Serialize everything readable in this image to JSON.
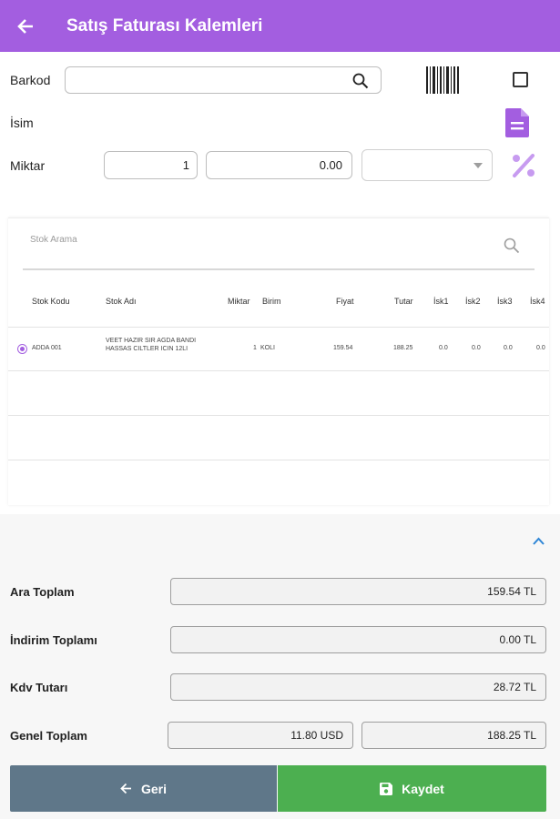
{
  "header": {
    "title": "Satış Faturası Kalemleri"
  },
  "form": {
    "barcode_label": "Barkod",
    "name_label": "İsim",
    "qty_label": "Miktar",
    "qty_value": "1",
    "price_value": "0.00"
  },
  "stock": {
    "search_placeholder": "Stok Arama",
    "columns": [
      "Stok Kodu",
      "Stok Adı",
      "Miktar",
      "Birim",
      "Fiyat",
      "Tutar",
      "İsk1",
      "İsk2",
      "İsk3",
      "İsk4"
    ],
    "rows": [
      {
        "code": "ADDA 001",
        "name": "VEET HAZIR SIR AGDA BANDI HASSAS CILTLER ICIN 12LI",
        "qty": "1",
        "unit": "KOLI",
        "price": "159.54",
        "total": "188.25",
        "d1": "0.0",
        "d2": "0.0",
        "d3": "0.0",
        "d4": "0.0"
      }
    ]
  },
  "summary": {
    "subtotal_label": "Ara Toplam",
    "subtotal_value": "159.54 TL",
    "discount_label": "İndirim Toplamı",
    "discount_value": "0.00 TL",
    "vat_label": "Kdv Tutarı",
    "vat_value": "28.72 TL",
    "grand_label": "Genel Toplam",
    "grand_usd": "11.80 USD",
    "grand_tl": "188.25 TL"
  },
  "actions": {
    "back_label": "Geri",
    "save_label": "Kaydet"
  },
  "colors": {
    "appbar": "#a35ee0",
    "back_button": "#5f7789",
    "save_button": "#4caf50",
    "accent": "#a35ee0"
  }
}
